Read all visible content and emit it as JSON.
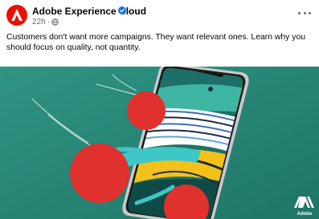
{
  "post": {
    "page_name": "Adobe Experience Cloud",
    "time": "22h",
    "separator": "·",
    "caption": "Customers don't want more campaigns. They want relevant ones. Learn why you should focus on quality, not quantity.",
    "more_icon": "more-horizontal-icon",
    "verified_icon": "verified-badge-icon",
    "audience_icon": "globe-icon"
  },
  "hero": {
    "brand_label": "Adobe",
    "background_color": "#2a8a7c"
  },
  "colors": {
    "adobe_red": "#eb1000",
    "verified_blue": "#1877f2",
    "meta_gray": "#65676b"
  }
}
